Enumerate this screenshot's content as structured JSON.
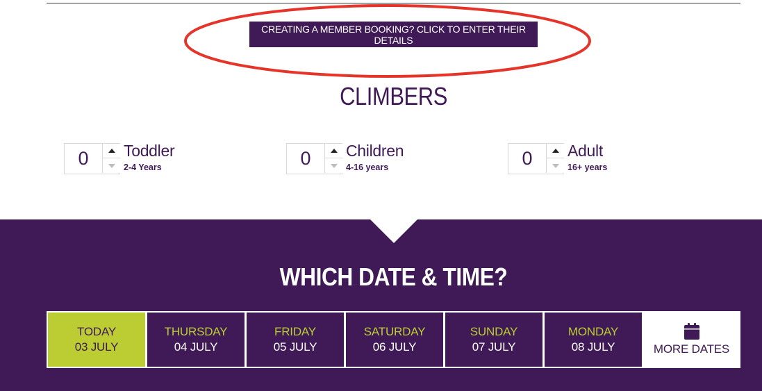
{
  "member_booking": {
    "label": "CREATING A MEMBER BOOKING? CLICK TO ENTER THEIR DETAILS"
  },
  "annotation": {
    "color": "#e5342a"
  },
  "climbers": {
    "title": "CLIMBERS",
    "items": [
      {
        "label": "Toddler",
        "range": "2-4 Years",
        "count": "0"
      },
      {
        "label": "Children",
        "range": "4-16 years",
        "count": "0"
      },
      {
        "label": "Adult",
        "range": "16+ years",
        "count": "0"
      }
    ]
  },
  "dates": {
    "title": "WHICH DATE & TIME?",
    "tiles": [
      {
        "day": "TODAY",
        "date": "03 JULY",
        "selected": true
      },
      {
        "day": "THURSDAY",
        "date": "04 JULY",
        "selected": false
      },
      {
        "day": "FRIDAY",
        "date": "05 JULY",
        "selected": false
      },
      {
        "day": "SATURDAY",
        "date": "06 JULY",
        "selected": false
      },
      {
        "day": "SUNDAY",
        "date": "07 JULY",
        "selected": false
      },
      {
        "day": "MONDAY",
        "date": "08 JULY",
        "selected": false
      }
    ],
    "more_label": "MORE DATES",
    "more_icon": "calendar-icon"
  },
  "colors": {
    "brand_purple": "#3f1a56",
    "accent_lime": "#bccd34",
    "annotation_red": "#e5342a"
  }
}
